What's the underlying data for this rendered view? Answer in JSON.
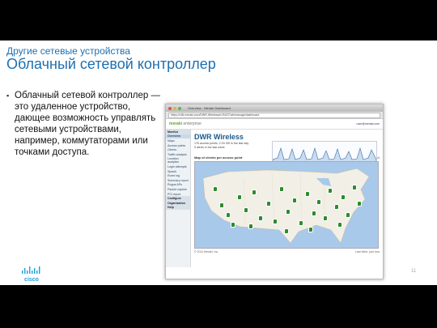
{
  "slide": {
    "subtitle": "Другие сетевые устройства",
    "title": "Облачный сетевой контроллер",
    "bullet": "Облачный сетевой контроллер — это удаленное устройство, дающее возможность управлять сетевыми устройствами, например, коммутаторами или точками доступа.",
    "logo_text": "cisco",
    "page_number": "11"
  },
  "screenshot": {
    "tab_title": "Overview - Meraki Dashboard",
    "url": "https://n36.meraki.com/DWR-Wireless/n/JN1S7wb/manage/dashboard",
    "brand": "meraki",
    "brand_suffix": "enterprise",
    "user_email": "user@meraki.com",
    "network_name": "DWR Wireless",
    "status_line": "176 access points, 2.93 GB in the last day",
    "status_line2": "9 alerts in the last week",
    "map_title": "Map of clients per access point",
    "map_summary": "All Accessible, 1 current alert",
    "sidebar": [
      {
        "label": "Monitor",
        "hdr": true
      },
      {
        "label": "Overview",
        "active": true
      },
      {
        "label": "Maps"
      },
      {
        "label": "Access points"
      },
      {
        "label": "Clients"
      },
      {
        "label": "Traffic analysis"
      },
      {
        "label": "Location analytics"
      },
      {
        "label": "Login attempts"
      },
      {
        "label": "Splash"
      },
      {
        "label": "Event log"
      },
      {
        "label": "Summary report"
      },
      {
        "label": "Rogue APs"
      },
      {
        "label": "Packet capture"
      },
      {
        "label": "PCI report"
      },
      {
        "label": "Configure",
        "hdr": true
      },
      {
        "label": "Organization",
        "hdr": true
      },
      {
        "label": "Help",
        "hdr": true
      }
    ],
    "footer_left": "© 2011 Meraki, Inc.",
    "footer_right": "Last fetch: just now",
    "colors": {
      "marker": "#2e8b2e",
      "map_land": "#f1efe6",
      "map_water": "#a9c9ea"
    }
  }
}
